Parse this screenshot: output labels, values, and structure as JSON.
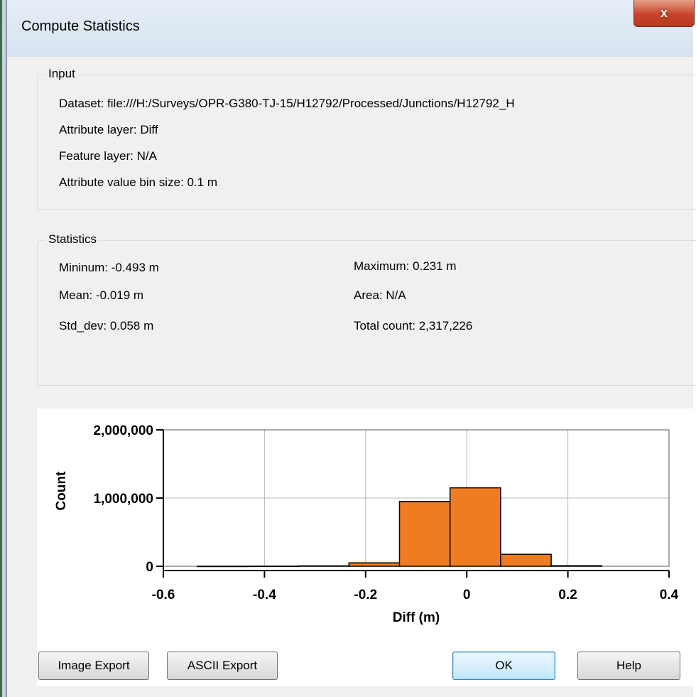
{
  "window": {
    "title": "Compute Statistics",
    "close_glyph": "x"
  },
  "input_group": {
    "label": "Input",
    "dataset_label": "Dataset:",
    "dataset_value": "file:///H:/Surveys/OPR-G380-TJ-15/H12792/Processed/Junctions/H12792_H",
    "attribute_layer_label": "Attribute layer:",
    "attribute_layer_value": "Diff",
    "feature_layer_label": "Feature layer:",
    "feature_layer_value": "N/A",
    "bin_size_label": "Attribute value bin size:",
    "bin_size_value": "0.1 m"
  },
  "statistics_group": {
    "label": "Statistics",
    "minimum_label": "Mininum:",
    "minimum_value": "-0.493 m",
    "mean_label": "Mean:",
    "mean_value": "-0.019 m",
    "std_dev_label": "Std_dev:",
    "std_dev_value": "0.058 m",
    "maximum_label": "Maximum:",
    "maximum_value": "0.231 m",
    "area_label": "Area:",
    "area_value": "N/A",
    "total_count_label": "Total count:",
    "total_count_value": "2,317,226"
  },
  "chart_data": {
    "type": "bar",
    "xlabel": "Diff (m)",
    "ylabel": "Count",
    "xlim": [
      -0.6,
      0.4
    ],
    "ylim": [
      0,
      2000000
    ],
    "x_ticks": [
      -0.6,
      -0.4,
      -0.2,
      0,
      0.2,
      0.4
    ],
    "x_tick_labels": [
      "-0.6",
      "-0.4",
      "-0.2",
      "0",
      "0.2",
      "0.4"
    ],
    "y_ticks": [
      0,
      1000000,
      2000000
    ],
    "y_tick_labels": [
      "0",
      "1,000,000",
      "2,000,000"
    ],
    "grid": true,
    "bar_color": "#f07c22",
    "bins": [
      {
        "x0": -0.533,
        "x1": -0.433,
        "value": 500
      },
      {
        "x0": -0.433,
        "x1": -0.333,
        "value": 1500
      },
      {
        "x0": -0.333,
        "x1": -0.233,
        "value": 6000
      },
      {
        "x0": -0.233,
        "x1": -0.133,
        "value": 50000
      },
      {
        "x0": -0.133,
        "x1": -0.033,
        "value": 950000
      },
      {
        "x0": -0.033,
        "x1": 0.067,
        "value": 1150000
      },
      {
        "x0": 0.067,
        "x1": 0.167,
        "value": 175000
      },
      {
        "x0": 0.167,
        "x1": 0.267,
        "value": 8000
      }
    ]
  },
  "buttons": {
    "image_export": "Image Export",
    "ascii_export": "ASCII Export",
    "ok": "OK",
    "help": "Help"
  }
}
